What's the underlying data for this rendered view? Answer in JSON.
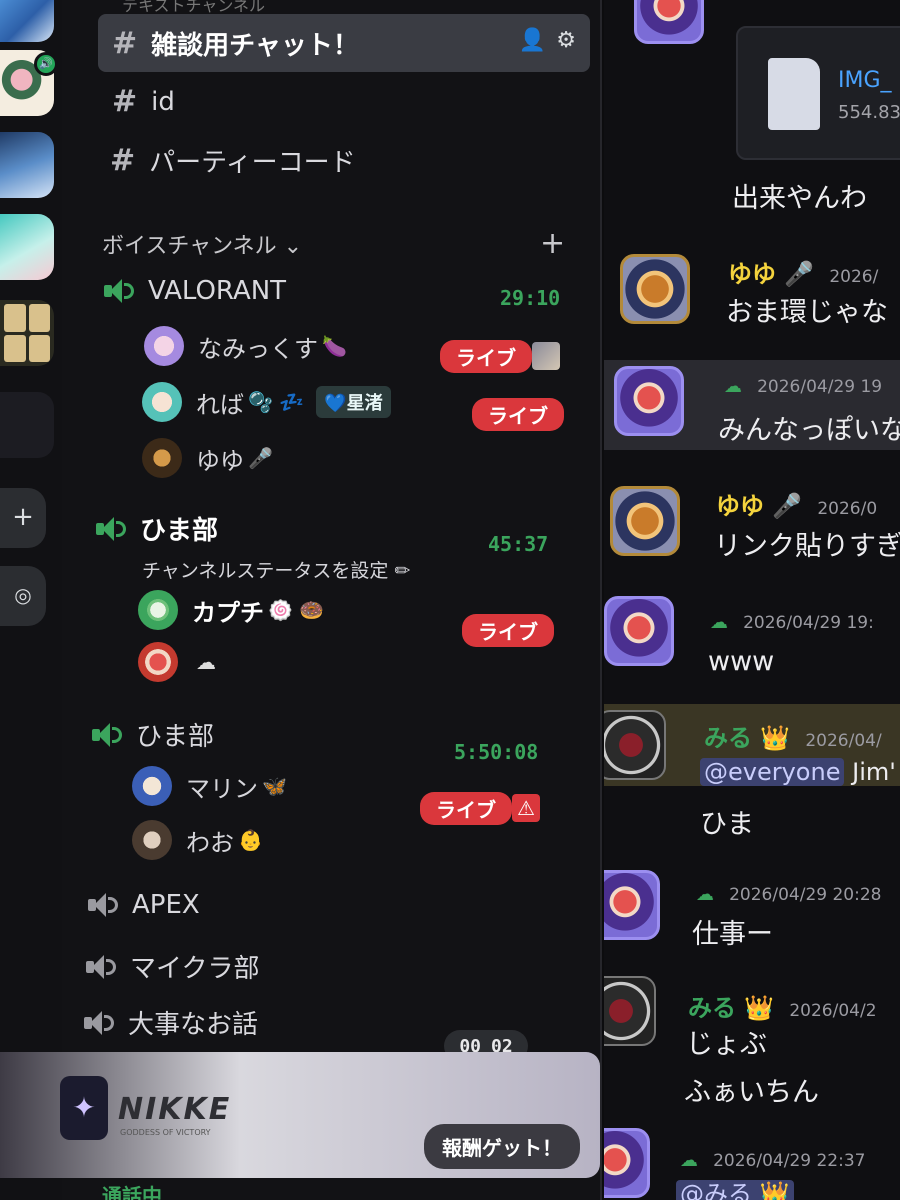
{
  "channels": {
    "cut_top_label": "テキストチャンネル",
    "selected": {
      "label": "雑談用チャット！"
    },
    "items": [
      {
        "label": "id"
      },
      {
        "label": "パーティーコード"
      }
    ]
  },
  "voice_category": {
    "label": "ボイスチャンネル ⌄"
  },
  "voice_channels": [
    {
      "name": "VALORANT",
      "timer": "29:10",
      "users": [
        {
          "name": "なみっくす",
          "emoji": "🍆",
          "live": "ライブ"
        },
        {
          "name": "れば",
          "emoji": "🫧 💤",
          "tag": "💙星渚",
          "live": "ライブ"
        },
        {
          "name": "ゆゆ",
          "emoji": "🎤"
        }
      ]
    },
    {
      "name": "ひま部",
      "timer": "45:37",
      "status": "チャンネルステータスを設定 ✏",
      "users": [
        {
          "name": "カプチ",
          "emoji": "🍥 🍩",
          "live": "ライブ"
        },
        {
          "name": "",
          "emoji": "☁"
        }
      ]
    },
    {
      "name": "ひま部",
      "timer": "5:50:08",
      "users": [
        {
          "name": "マリン",
          "emoji": "🦋",
          "live": "ライブ"
        },
        {
          "name": "わお",
          "emoji": "👶"
        }
      ]
    },
    {
      "name": "APEX"
    },
    {
      "name": "マイクラ部"
    },
    {
      "name": "大事なお話"
    }
  ],
  "pager": {
    "left": "00",
    "right": "02"
  },
  "promo": {
    "logo": "NIKKE",
    "sub": "GODDESS OF VICTORY",
    "cta": "報酬ゲット！"
  },
  "voice_connected": "通話中",
  "chat": {
    "file": {
      "name": "IMG_",
      "size": "554.83"
    },
    "messages": [
      {
        "body": "出来やんわ"
      },
      {
        "author": "ゆゆ 🎤",
        "time": "2026/",
        "body": "おま環じゃな"
      },
      {
        "author": "☁",
        "time": "2026/04/29 19",
        "body": "みんなっぽいな"
      },
      {
        "author": "ゆゆ 🎤",
        "time": "2026/0",
        "body": "リンク貼りすぎ"
      },
      {
        "author": "☁",
        "time": "2026/04/29 19:",
        "body": "www"
      },
      {
        "author": "みる 👑",
        "time": "2026/04/",
        "mention": "@everyone",
        "body": "Jim'"
      },
      {
        "body": "ひま"
      },
      {
        "author": "☁",
        "time": "2026/04/29 20:28",
        "body": "仕事ー"
      },
      {
        "author": "みる 👑",
        "time": "2026/04/2",
        "body": "じょぶ"
      },
      {
        "body": "ふぁいちん"
      },
      {
        "author": "☁",
        "time": "2026/04/29 22:37",
        "mention": "@みる 👑"
      }
    ]
  }
}
